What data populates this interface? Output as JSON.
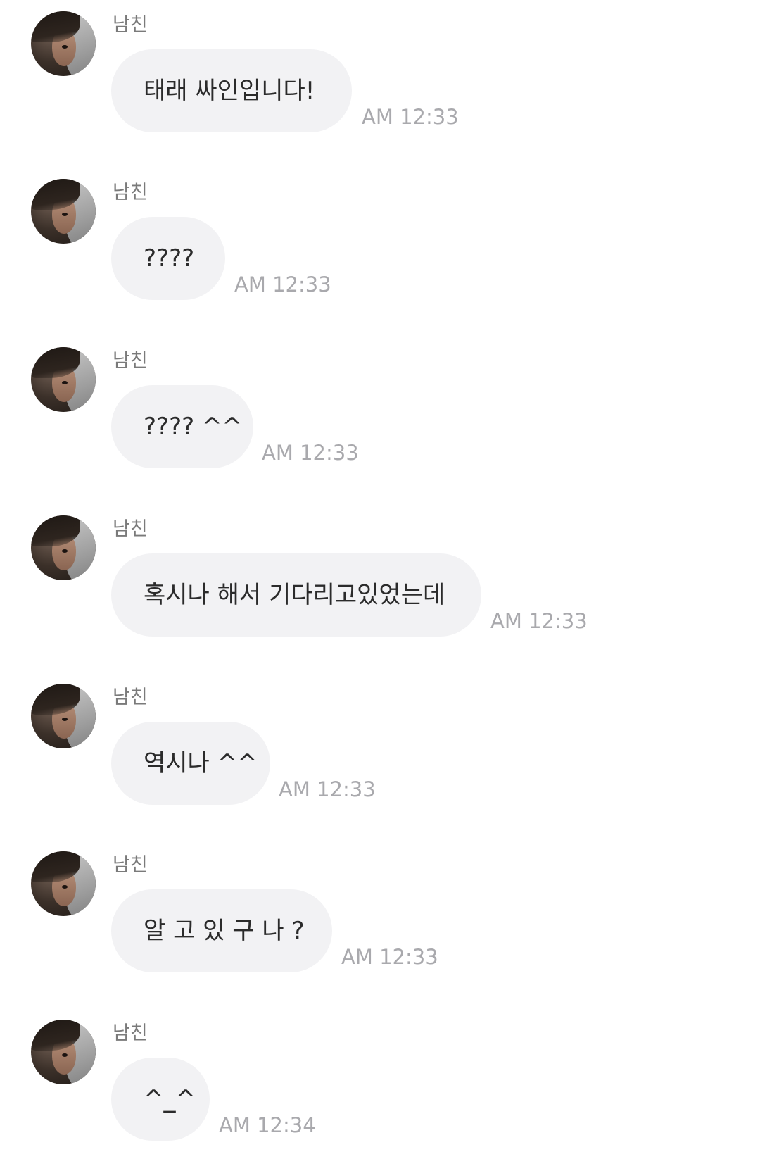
{
  "messages": [
    {
      "sender": "남친",
      "text": "태래 싸인입니다!",
      "time": "AM 12:33"
    },
    {
      "sender": "남친",
      "text": "????",
      "time": "AM 12:33"
    },
    {
      "sender": "남친",
      "text": "???? ^^",
      "time": "AM 12:33"
    },
    {
      "sender": "남친",
      "text": "혹시나 해서 기다리고있었는데",
      "time": "AM 12:33"
    },
    {
      "sender": "남친",
      "text": "역시나 ^^",
      "time": "AM 12:33"
    },
    {
      "sender": "남친",
      "text": "알 고 있 구 나 ?",
      "time": "AM 12:33"
    },
    {
      "sender": "남친",
      "text": "^_^",
      "time": "AM 12:34"
    }
  ]
}
